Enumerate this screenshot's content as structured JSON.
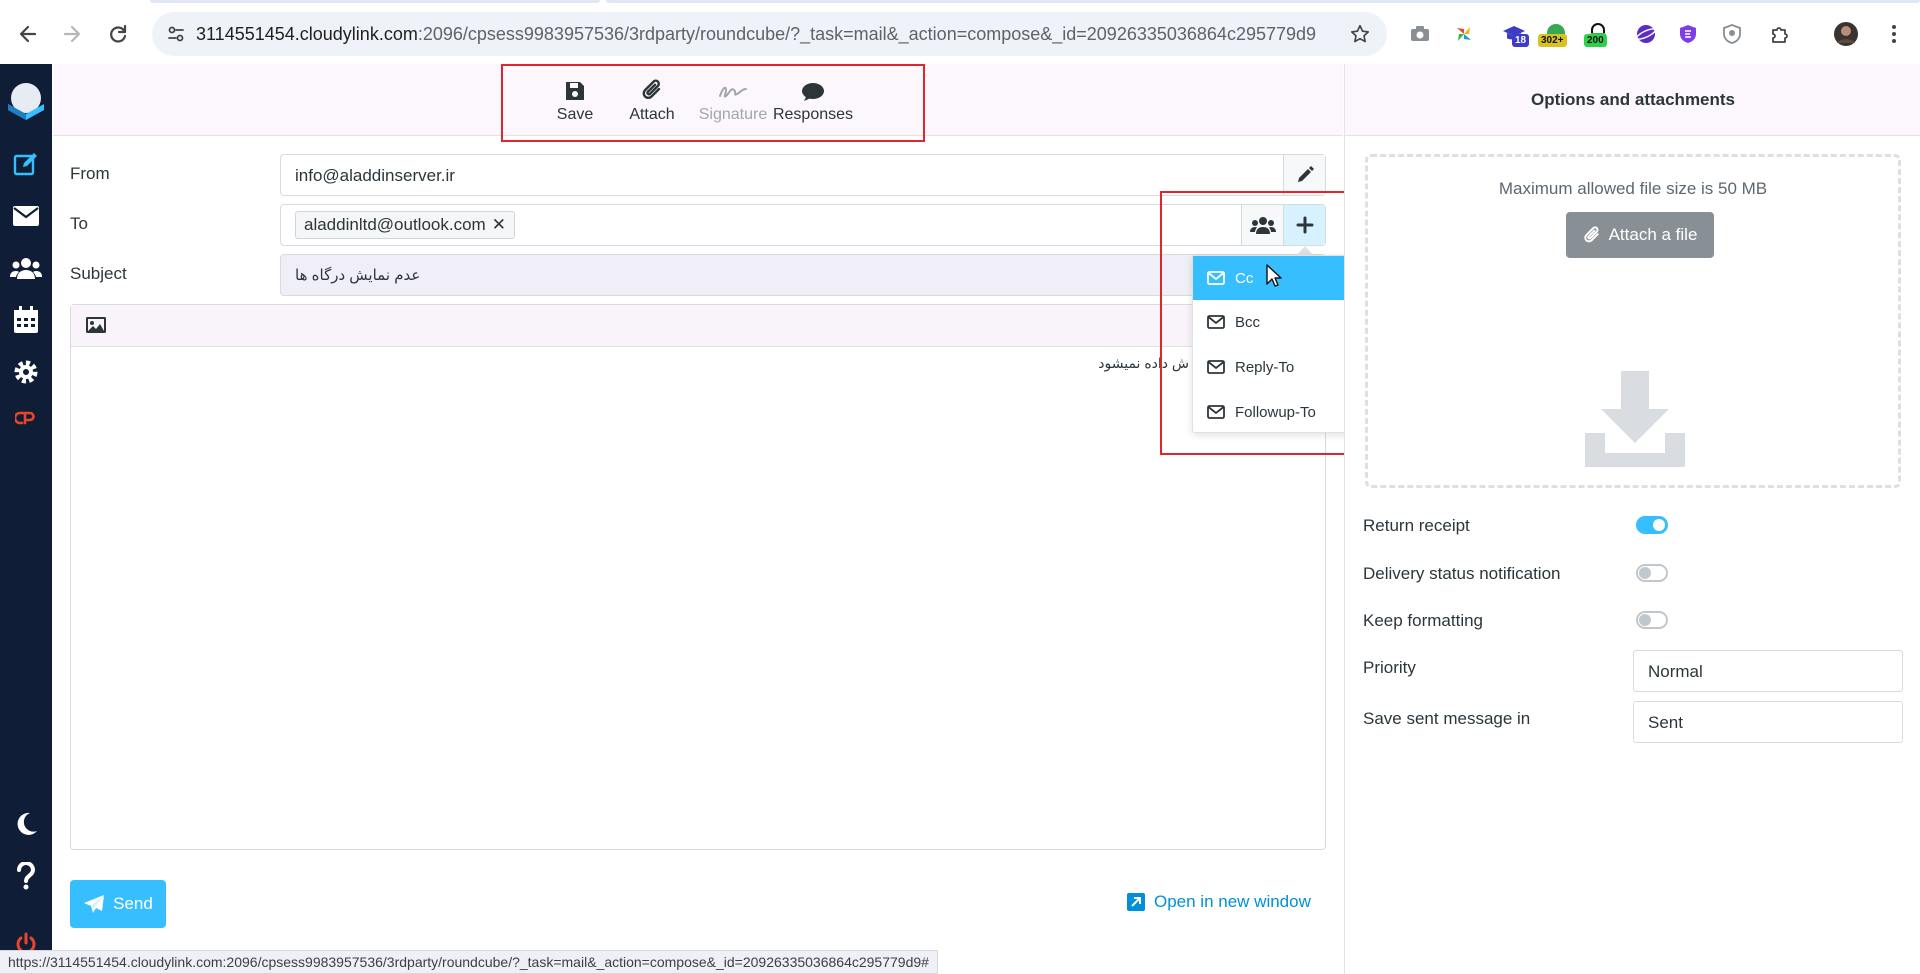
{
  "browser": {
    "url_host": "3114551454.cloudylink.com",
    "url_rest": ":2096/cpsess9983957536/3rdparty/roundcube/?_task=mail&_action=compose&_id=20926335036864c295779d9#add...",
    "extensions": [
      {
        "name": "camera",
        "badge": ""
      },
      {
        "name": "pinwheel",
        "badge": ""
      },
      {
        "name": "graduation-cap",
        "badge": "18"
      },
      {
        "name": "green-ext",
        "badge": "302+"
      },
      {
        "name": "green-lock",
        "badge": "200"
      },
      {
        "name": "purple-planet",
        "badge": ""
      },
      {
        "name": "purple-shield",
        "badge": ""
      },
      {
        "name": "grey-shield",
        "badge": ""
      },
      {
        "name": "puzzle",
        "badge": ""
      }
    ],
    "status_url": "https://3114551454.cloudylink.com:2096/cpsess9983957536/3rdparty/roundcube/?_task=mail&_action=compose&_id=20926335036864c295779d9#"
  },
  "toolbar": {
    "save_label": "Save",
    "attach_label": "Attach",
    "signature_label": "Signature",
    "responses_label": "Responses"
  },
  "compose": {
    "from_label": "From",
    "from_value": "info@aladdinserver.ir",
    "to_label": "To",
    "to_recipient": "aladdinltd@outlook.com",
    "subject_label": "Subject",
    "subject_value": "عدم نمایش درگاه ها",
    "body_text": "ش داده نمیشود"
  },
  "header_menu": {
    "items": [
      "Cc",
      "Bcc",
      "Reply-To",
      "Followup-To"
    ],
    "active": "Cc"
  },
  "actions": {
    "send_label": "Send",
    "open_window_label": "Open in new window"
  },
  "options_panel": {
    "title": "Options and attachments",
    "max_size_text": "Maximum allowed file size is 50 MB",
    "attach_file_label": "Attach a file",
    "return_receipt_label": "Return receipt",
    "return_receipt_on": true,
    "dsn_label": "Delivery status notification",
    "dsn_on": false,
    "keep_formatting_label": "Keep formatting",
    "keep_formatting_on": false,
    "priority_label": "Priority",
    "priority_value": "Normal",
    "save_sent_label": "Save sent message in",
    "save_sent_value": "Sent"
  },
  "colors": {
    "accent": "#37beff",
    "nav_bg": "#0f1e36",
    "highlight_red": "#e0262c",
    "link": "#0090d9"
  }
}
